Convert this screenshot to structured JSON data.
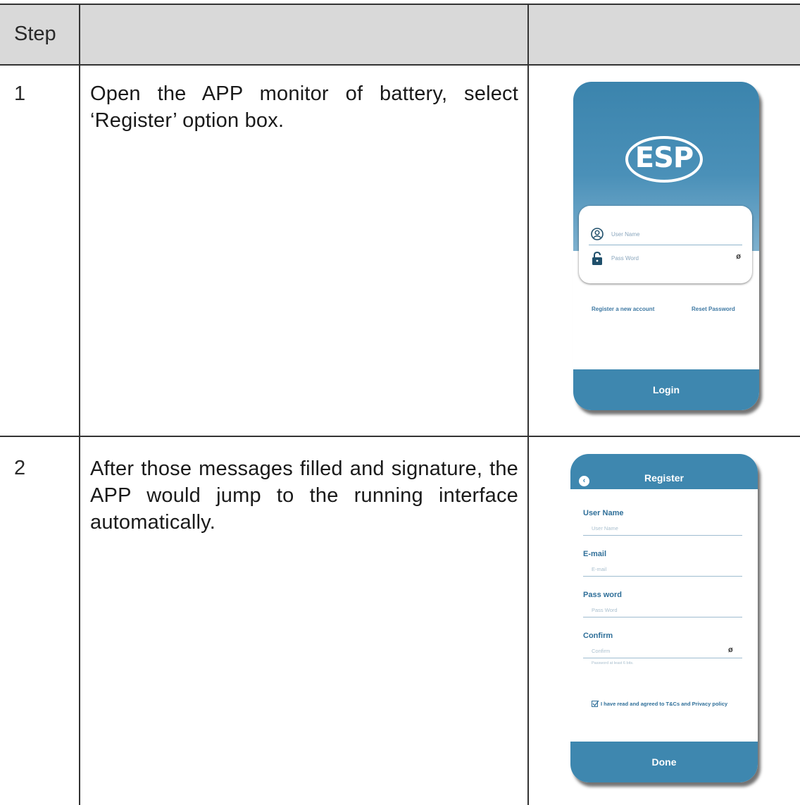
{
  "table": {
    "header": {
      "col1": "Step",
      "col2": "",
      "col3": ""
    },
    "rows": [
      {
        "step": "1",
        "description": "Open the APP monitor of battery, select ‘Register’ option box."
      },
      {
        "step": "2",
        "description": "After those messages filled and signature, the APP would jump to the running interface automatically."
      }
    ]
  },
  "login_screen": {
    "logo": "ESP",
    "username_placeholder": "User Name",
    "password_placeholder": "Pass Word",
    "register_link": "Register a  new account",
    "reset_link": "Reset Password",
    "login_button": "Login",
    "accent_color": "#3e87af"
  },
  "register_screen": {
    "title": "Register",
    "fields": [
      {
        "label": "User Name",
        "placeholder": "User Name"
      },
      {
        "label": "E-mail",
        "placeholder": "E-mail"
      },
      {
        "label": "Pass word",
        "placeholder": "Pass Word"
      },
      {
        "label": "Confirm",
        "placeholder": "Confirm"
      }
    ],
    "password_hint": "Password at least 6 bits.",
    "agree_text": "I have read and agreed to T&Cs and Privacy policy",
    "done_button": "Done"
  }
}
